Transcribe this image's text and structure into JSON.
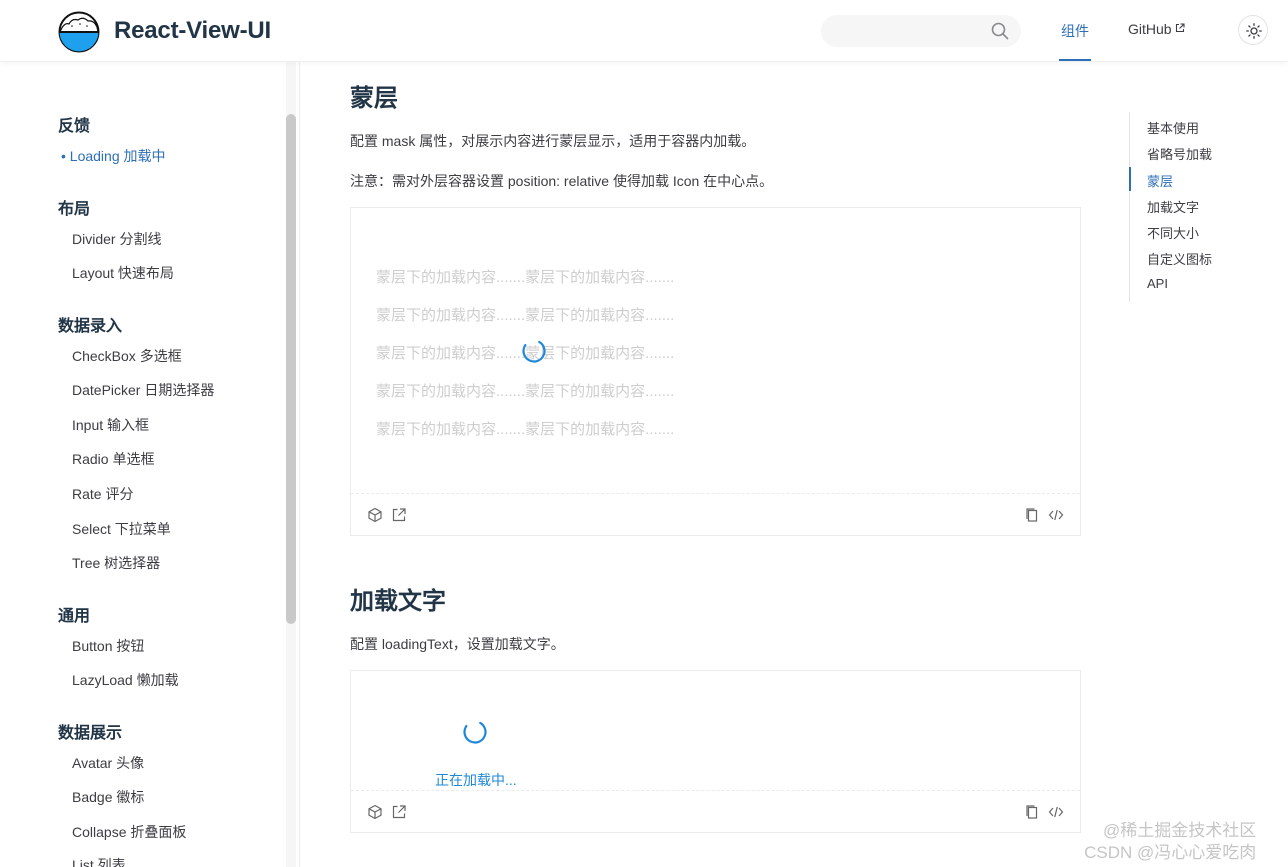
{
  "header": {
    "brand": "React-View-UI",
    "search_placeholder": "",
    "nav": [
      {
        "label": "组件"
      },
      {
        "label": "GitHub"
      }
    ]
  },
  "sidebar": {
    "groups": [
      {
        "title": "反馈",
        "items": [
          "• Loading 加载中"
        ]
      },
      {
        "title": "布局",
        "items": [
          "Divider 分割线",
          "Layout 快速布局"
        ]
      },
      {
        "title": "数据录入",
        "items": [
          "CheckBox 多选框",
          "DatePicker 日期选择器",
          "Input 输入框",
          "Radio 单选框",
          "Rate 评分",
          "Select 下拉菜单",
          "Tree 树选择器"
        ]
      },
      {
        "title": "通用",
        "items": [
          "Button 按钮",
          "LazyLoad 懒加载"
        ]
      },
      {
        "title": "数据展示",
        "items": [
          "Avatar 头像",
          "Badge 徽标",
          "Collapse 折叠面板",
          "List 列表"
        ]
      }
    ]
  },
  "main": {
    "mask_section": {
      "title": "蒙层",
      "desc": "配置 mask 属性，对展示内容进行蒙层显示，适用于容器内加载。",
      "note": "注意：需对外层容器设置 position: relative 使得加载 Icon 在中心点。",
      "lines": [
        "蒙层下的加载内容.......蒙层下的加载内容.......",
        "蒙层下的加载内容.......蒙层下的加载内容.......",
        "蒙层下的加载内容.......蒙层下的加载内容.......",
        "蒙层下的加载内容.......蒙层下的加载内容.......",
        "蒙层下的加载内容.......蒙层下的加载内容......."
      ]
    },
    "text_section": {
      "title": "加载文字",
      "desc": "配置 loadingText，设置加载文字。",
      "loading_text": "正在加载中..."
    }
  },
  "toc": {
    "items": [
      "基本使用",
      "省略号加载",
      "蒙层",
      "加载文字",
      "不同大小",
      "自定义图标",
      "API"
    ],
    "active_index": 2
  },
  "watermark": {
    "line1": "@稀土掘金技术社区",
    "line2": "CSDN @冯心心爱吃肉"
  },
  "colors": {
    "accent": "#2c6fb7",
    "spinner": "#1f88d6"
  }
}
